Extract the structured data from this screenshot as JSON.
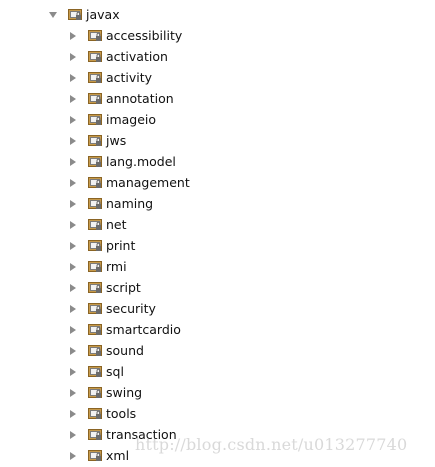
{
  "tree": {
    "root": {
      "label": "javax",
      "expanded": true,
      "icon": "package-folder-icon"
    },
    "children": [
      {
        "label": "accessibility",
        "expanded": false,
        "icon": "package-folder-icon"
      },
      {
        "label": "activation",
        "expanded": false,
        "icon": "package-folder-icon"
      },
      {
        "label": "activity",
        "expanded": false,
        "icon": "package-folder-icon"
      },
      {
        "label": "annotation",
        "expanded": false,
        "icon": "package-folder-icon"
      },
      {
        "label": "imageio",
        "expanded": false,
        "icon": "package-folder-icon"
      },
      {
        "label": "jws",
        "expanded": false,
        "icon": "package-folder-icon"
      },
      {
        "label": "lang.model",
        "expanded": false,
        "icon": "package-folder-icon"
      },
      {
        "label": "management",
        "expanded": false,
        "icon": "package-folder-icon"
      },
      {
        "label": "naming",
        "expanded": false,
        "icon": "package-folder-icon"
      },
      {
        "label": "net",
        "expanded": false,
        "icon": "package-folder-icon"
      },
      {
        "label": "print",
        "expanded": false,
        "icon": "package-folder-icon"
      },
      {
        "label": "rmi",
        "expanded": false,
        "icon": "package-folder-icon"
      },
      {
        "label": "script",
        "expanded": false,
        "icon": "package-folder-icon"
      },
      {
        "label": "security",
        "expanded": false,
        "icon": "package-folder-icon"
      },
      {
        "label": "smartcardio",
        "expanded": false,
        "icon": "package-folder-icon"
      },
      {
        "label": "sound",
        "expanded": false,
        "icon": "package-folder-icon"
      },
      {
        "label": "sql",
        "expanded": false,
        "icon": "package-folder-icon"
      },
      {
        "label": "swing",
        "expanded": false,
        "icon": "package-folder-icon"
      },
      {
        "label": "tools",
        "expanded": false,
        "icon": "package-folder-icon"
      },
      {
        "label": "transaction",
        "expanded": false,
        "icon": "package-folder-icon"
      },
      {
        "label": "xml",
        "expanded": false,
        "icon": "package-folder-icon"
      }
    ]
  },
  "watermark": {
    "text": "http://blog.csdn.net/u013277740"
  },
  "colors": {
    "folder_fill": "#c79a4a",
    "folder_dark": "#8a6424",
    "lock_fill": "#6b6b6b",
    "arrow": "#8b8b8b",
    "text": "#111111",
    "watermark": "#d2d2d2"
  }
}
